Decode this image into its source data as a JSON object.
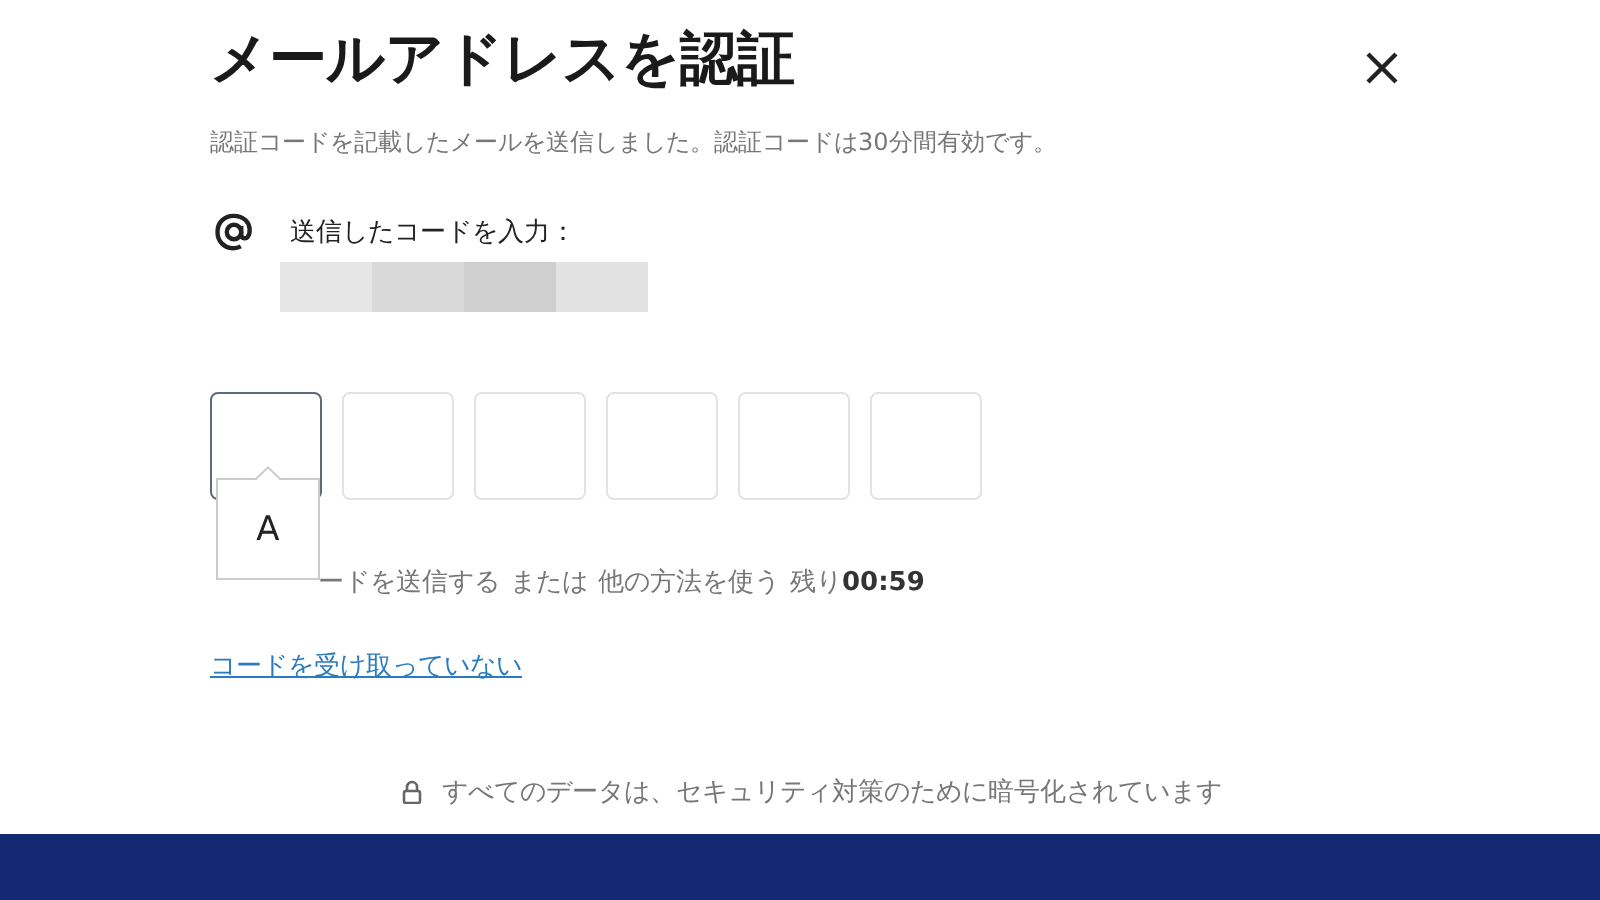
{
  "dialog": {
    "title": "メールアドレスを認証",
    "subtitle": "認証コードを記載したメールを送信しました。認証コードは30分間有効です。"
  },
  "email_label": "送信したコードを入力：",
  "code_boxes": [
    {
      "focused": true
    },
    {
      "focused": false
    },
    {
      "focused": false
    },
    {
      "focused": false
    },
    {
      "focused": false
    },
    {
      "focused": false
    }
  ],
  "tooltip": "A",
  "resend_line": {
    "resend": "ードを送信する",
    "or": "または",
    "other": "他の方法を使う",
    "remaining": "残り",
    "timer": "00:59"
  },
  "no_code_link": "コードを受け取っていない",
  "footer": "すべてのデータは、セキュリティ対策のために暗号化されています"
}
